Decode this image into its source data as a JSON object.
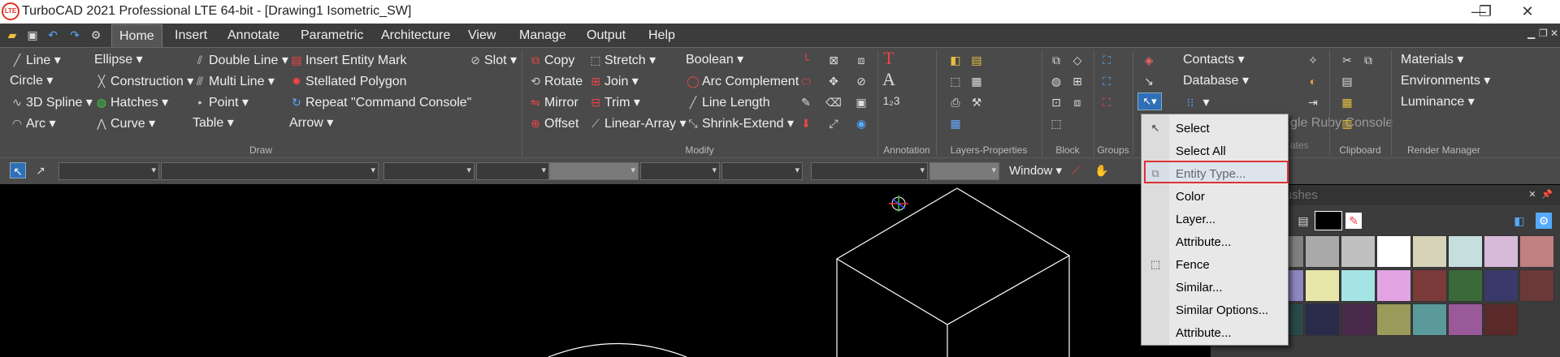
{
  "window": {
    "logo": "LTE",
    "title": "TurboCAD 2021 Professional LTE 64-bit - [Drawing1 Isometric_SW]",
    "min": "—",
    "max": "❐",
    "close": "✕"
  },
  "qat": [
    "folder-icon",
    "save-icon",
    "undo-icon",
    "redo-icon",
    "settings-icon"
  ],
  "menu": [
    "Home",
    "Insert",
    "Annotate",
    "Parametric",
    "Architecture",
    "View",
    "Manage",
    "Output",
    "Help"
  ],
  "mdi": {
    "min": "▁",
    "max": "❐",
    "close": "✕"
  },
  "draw": {
    "line": "Line",
    "circle": "Circle",
    "spline": "3D Spline",
    "arc": "Arc",
    "ellipse": "Ellipse",
    "construction": "Construction",
    "hatches": "Hatches",
    "curve": "Curve",
    "double_line": "Double Line",
    "multi_line": "Multi Line",
    "point": "Point",
    "table": "Table",
    "insert_entity_mark": "Insert Entity Mark",
    "stellated_polygon": "Stellated Polygon",
    "repeat": "Repeat \"Command Console\"",
    "arrow": "Arrow",
    "slot": "Slot"
  },
  "modify": {
    "copy": "Copy",
    "rotate": "Rotate",
    "mirror": "Mirror",
    "offset": "Offset",
    "stretch": "Stretch",
    "join": "Join",
    "trim": "Trim",
    "linear_array": "Linear-Array",
    "boolean": "Boolean",
    "arc_complement": "Arc Complement",
    "line_length": "Line Length",
    "shrink_extend": "Shrink-Extend"
  },
  "groups": [
    "Draw",
    "Modify",
    "Annotation",
    "Layers-Properties",
    "Block",
    "Groups",
    "Clipboard",
    "Render Manager"
  ],
  "select_group": {
    "contacts": "Contacts",
    "database": "Database",
    "ghost": "gle Ruby Console",
    "ghost2": "ates"
  },
  "render": {
    "materials": "Materials",
    "environments": "Environments",
    "luminance": "Luminance"
  },
  "annotation": {
    "t": "T",
    "a": "A",
    "num": "1₂3"
  },
  "propbar": {
    "window": "Window"
  },
  "panel": {
    "title": "Colors and Brushes"
  },
  "colors": [
    "#000000",
    "#808080",
    "#a9a9a9",
    "#c0c0c0",
    "#ffffff",
    "#d6d3b8",
    "#c5dede",
    "#d9b9d9",
    "#c08080",
    "#4a4a4a",
    "#8e88c0",
    "#e8e6a8",
    "#a4e4e4",
    "#e4a4e4",
    "#7a3a3a",
    "#3a6a3a",
    "#3a3a6a",
    "#6a3a3a",
    "#3a7a3a",
    "#2a4a4a",
    "#2a2a4a",
    "#4a2a4a",
    "#9a9a5a",
    "#5a9a9a",
    "#9a5a9a",
    "#5a2a2a"
  ],
  "context_menu": [
    {
      "label": "Select",
      "icon": "select-arrow-icon"
    },
    {
      "label": "Select All",
      "icon": ""
    },
    {
      "label": "Entity Type...",
      "icon": "entity-type-icon"
    },
    {
      "label": "Color",
      "icon": ""
    },
    {
      "label": "Layer...",
      "icon": ""
    },
    {
      "label": "Attribute...",
      "icon": ""
    },
    {
      "label": "Fence",
      "icon": "fence-icon"
    },
    {
      "label": "Similar...",
      "icon": ""
    },
    {
      "label": "Similar Options...",
      "icon": ""
    },
    {
      "label": "Attribute...",
      "icon": ""
    }
  ]
}
